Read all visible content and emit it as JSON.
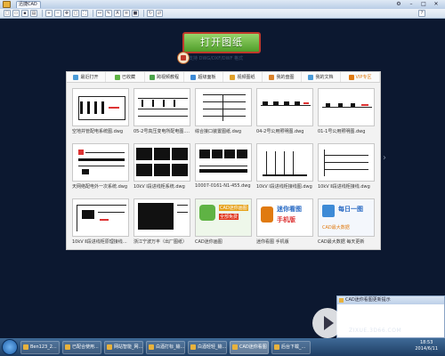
{
  "titlebar": {
    "tab_label": "迅捷CAD"
  },
  "toolbar": {
    "buttons": [
      "新建",
      "打开",
      "保存",
      "打印",
      "放大",
      "缩小",
      "平移",
      "窗口",
      "全屏",
      "测量",
      "标注",
      "文字",
      "图层",
      "颜色",
      "旋转",
      "比较"
    ]
  },
  "main": {
    "open_button_label": "打开图纸",
    "open_button_subtext": "支持 DWG/DXF/DWF 格式"
  },
  "tabs": [
    {
      "label": "最近打开",
      "color": "#4a9bd8"
    },
    {
      "label": "已收藏",
      "color": "#5fb344"
    },
    {
      "label": "跨视频教程",
      "color": "#4aa34a"
    },
    {
      "label": "超级面板",
      "color": "#3d8ad6"
    },
    {
      "label": "视频图纸",
      "color": "#e0a12a"
    },
    {
      "label": "我的盘图",
      "color": "#d9822b"
    },
    {
      "label": "我的文档",
      "color": "#4a9bd8"
    },
    {
      "label": "VIP专区",
      "color": "#e07a10"
    }
  ],
  "files": [
    "空地并管配电系统图.dwg",
    "05-2号高压变电所配电图.dwg",
    "综合接口装置图纸.dwg",
    "04-2号公用照明图.dwg",
    "01-1号公用照明图.dwg",
    "天网络配电外一次系统.dwg",
    "10kV Ⅰ段进线柜系统.dwg",
    "10007-0161-N1-455.dwg",
    "10kV Ⅰ段进线柜接线图.dwg",
    "10kV Ⅱ段进线柜接线.dwg",
    "10kV Ⅱ段进线柜原理接线图.dwg",
    "浙江宁波万丰（出厂图纸）",
    "CAD迷你画图",
    "迷你看图 手机版",
    "CAD最大数据 每天更新"
  ],
  "promos": {
    "card12_badge": "CAD迷你画图",
    "card13_title": "迷你看图",
    "card13_sub": "手机版",
    "card14_title": "每日一图",
    "card14_sub": "CAD最大数据"
  },
  "notification": {
    "title": "CAD迷你看图更新提示"
  },
  "watermark": {
    "brand": "溜溜自学",
    "url": "ZIXUE.3D66.COM"
  },
  "taskbar": {
    "tasks": [
      "Ben123_2...",
      "已配合使用...",
      "网站智能_网...",
      "白酒打标_输...",
      "白酒轻轻_输...",
      "CAD迷你看图",
      "后台下载_..."
    ],
    "time": "18:53",
    "date": "2014/6/11"
  }
}
